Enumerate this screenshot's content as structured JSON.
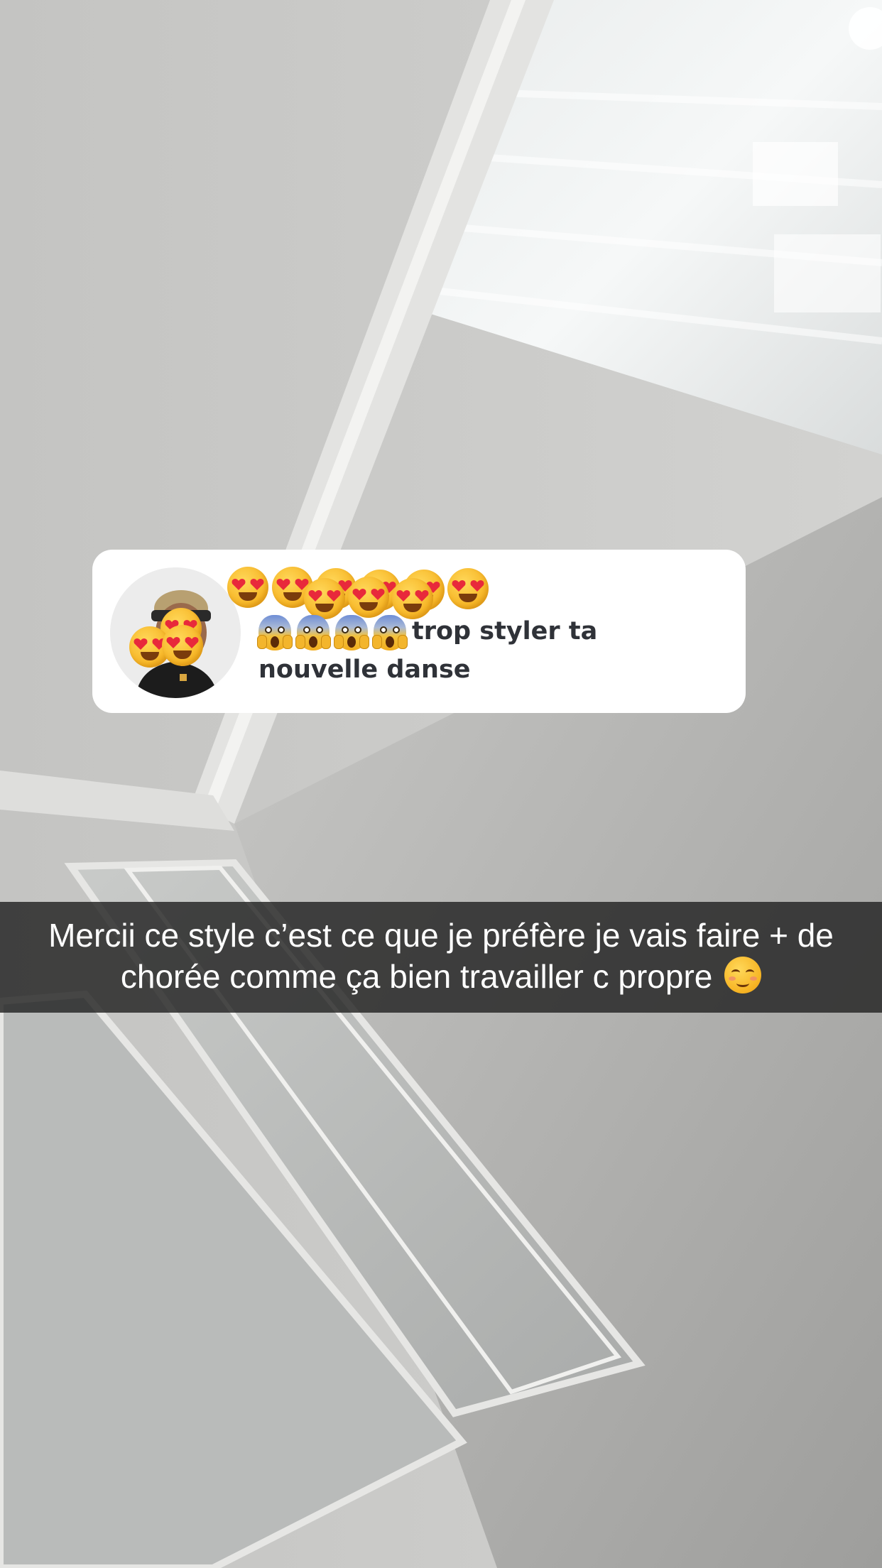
{
  "story": {
    "reply_card": {
      "avatar_icon": "bitmoji-avatar",
      "sticker_emoji": "smiling-face-with-heart-eyes",
      "leading_emoji": "face-screaming-in-fear",
      "message_text": "trop styler ta nouvelle danse"
    },
    "caption": {
      "text": "Mercii ce style c’est ce que je préfère je vais faire + de chorée comme ça bien travailler c propre",
      "trailing_emoji": "smiling-face-icon"
    }
  },
  "colors": {
    "card_background": "#ffffff",
    "card_text": "#2f3238",
    "caption_bar": "#222222",
    "caption_text": "#ffffff"
  }
}
